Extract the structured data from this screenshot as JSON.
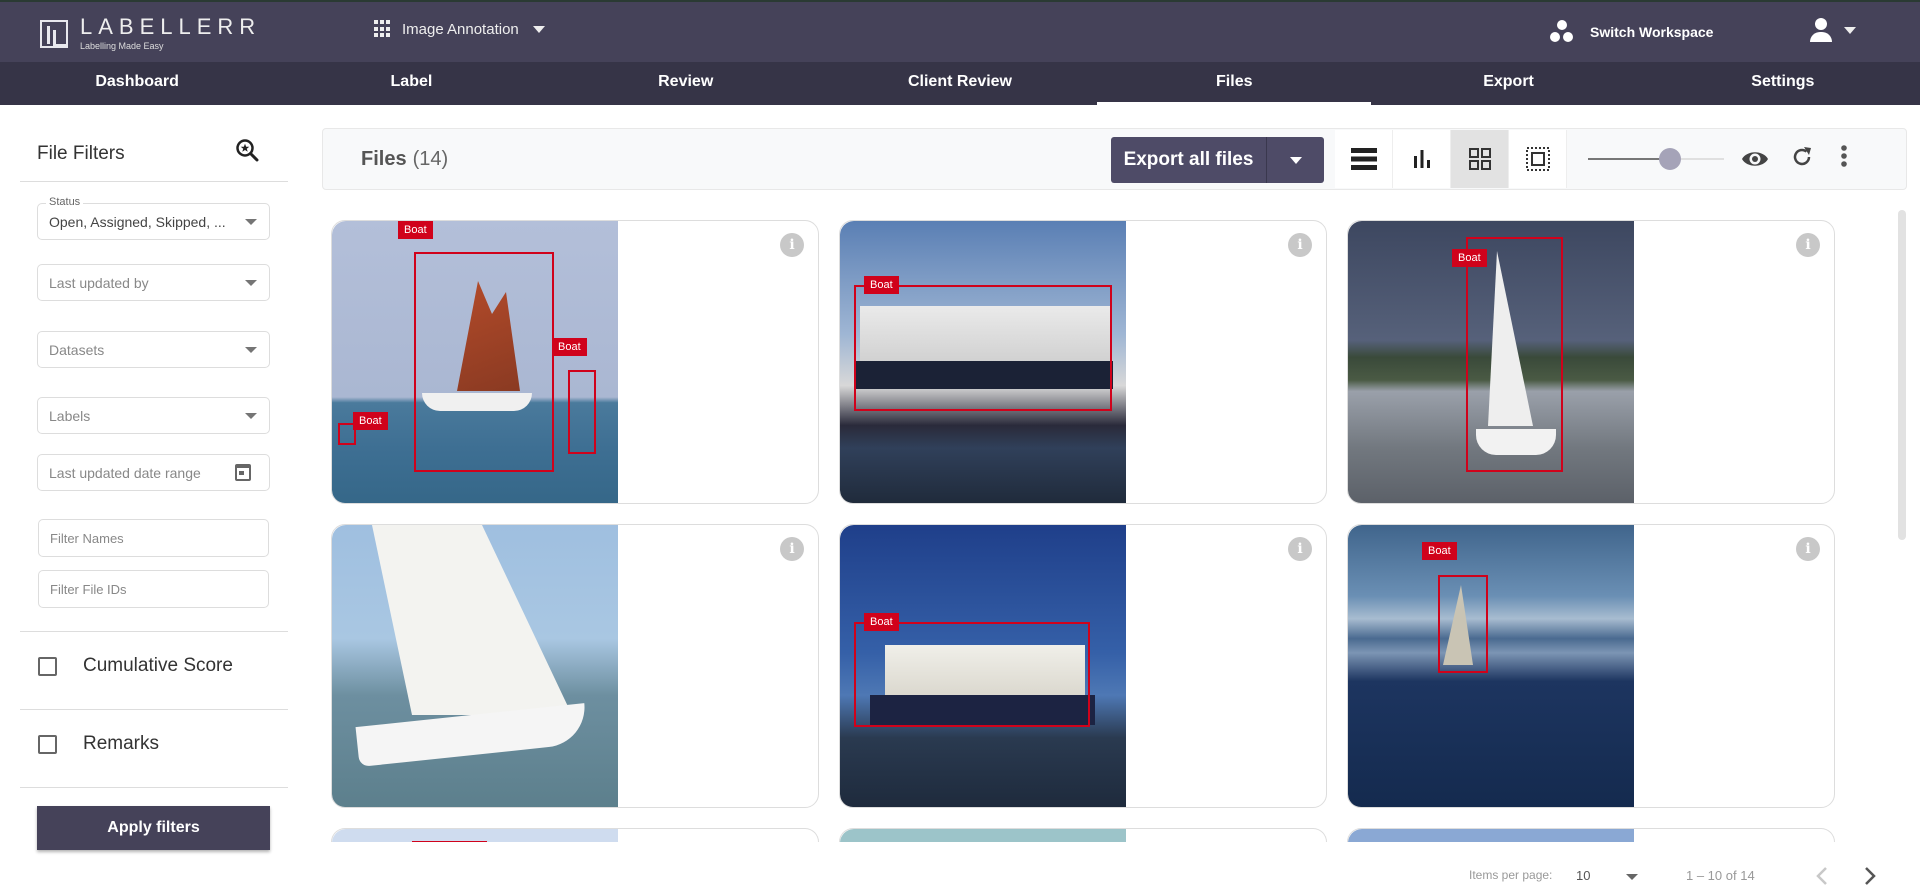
{
  "header": {
    "brand_name": "LABELLERR",
    "brand_tagline": "Labelling Made Easy",
    "app_switcher": "Image Annotation",
    "workspace_label": "Switch Workspace"
  },
  "nav": {
    "items": [
      {
        "label": "Dashboard",
        "active": false
      },
      {
        "label": "Label",
        "active": false
      },
      {
        "label": "Review",
        "active": false
      },
      {
        "label": "Client Review",
        "active": false
      },
      {
        "label": "Files",
        "active": true
      },
      {
        "label": "Export",
        "active": false
      },
      {
        "label": "Settings",
        "active": false
      }
    ]
  },
  "filters": {
    "title": "File Filters",
    "status_label": "Status",
    "status_value": "Open, Assigned, Skipped, ...",
    "last_updated_by": "Last updated by",
    "datasets": "Datasets",
    "labels": "Labels",
    "date_range": "Last updated date range",
    "filter_names_placeholder": "Filter Names",
    "filter_ids_placeholder": "Filter File IDs",
    "cumulative_score": "Cumulative Score",
    "remarks": "Remarks",
    "apply": "Apply filters"
  },
  "toolbar": {
    "title": "Files",
    "count": "(14)",
    "export_label": "Export all files",
    "view_modes": [
      "list-view",
      "chart-view",
      "grid-view",
      "focus-view"
    ],
    "active_view": "grid-view",
    "zoom_percent": 60
  },
  "colors": {
    "header_bg": "#454259",
    "nav_bg": "#363447",
    "annotation": "#d0021b",
    "button_bg": "#454259"
  },
  "files": [
    {
      "label": "Boat",
      "annotations": 3
    },
    {
      "label": "Boat",
      "annotations": 1
    },
    {
      "label": "Boat",
      "annotations": 1
    },
    {
      "label": "",
      "annotations": 0
    },
    {
      "label": "Boat",
      "annotations": 1
    },
    {
      "label": "Boat",
      "annotations": 1
    }
  ],
  "pagination": {
    "items_per_page_label": "Items per page:",
    "items_per_page": "10",
    "range": "1 – 10 of 14"
  }
}
